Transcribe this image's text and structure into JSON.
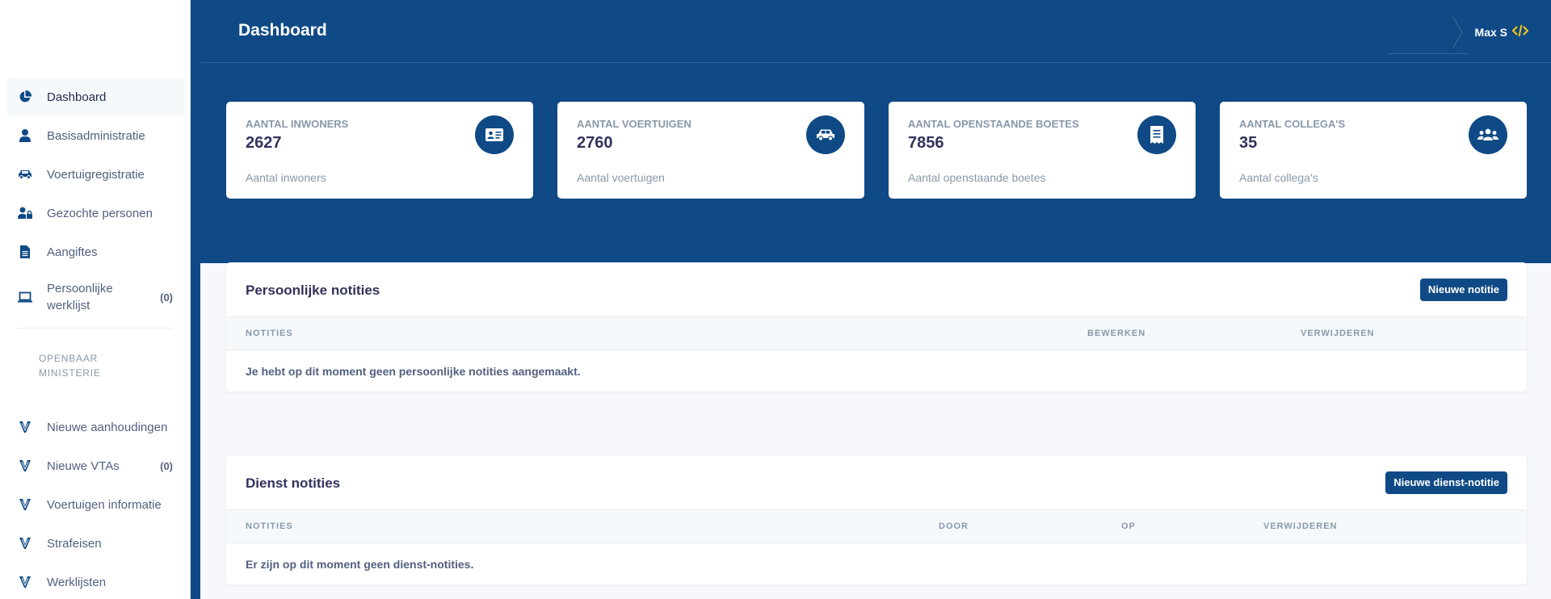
{
  "sidebar": {
    "items": [
      {
        "label": "Dashboard",
        "icon": "chart-pie-icon",
        "active": true
      },
      {
        "label": "Basisadministratie",
        "icon": "user-icon"
      },
      {
        "label": "Voertuigregistratie",
        "icon": "car-icon"
      },
      {
        "label": "Gezochte personen",
        "icon": "user-lock-icon"
      },
      {
        "label": "Aangiftes",
        "icon": "file-icon"
      },
      {
        "label": "Persoonlijke werklijst",
        "icon": "laptop-icon",
        "count": "(0)"
      }
    ],
    "section_heading": "OPENBAAR MINISTERIE",
    "om_items": [
      {
        "label": "Nieuwe aanhoudingen",
        "icon": "scales-icon"
      },
      {
        "label": "Nieuwe VTAs",
        "icon": "scales-icon",
        "count": "(0)"
      },
      {
        "label": "Voertuigen informatie",
        "icon": "scales-icon"
      },
      {
        "label": "Strafeisen",
        "icon": "scales-icon"
      },
      {
        "label": "Werklijsten",
        "icon": "scales-icon"
      }
    ]
  },
  "header": {
    "title": "Dashboard",
    "user_name": "Max S",
    "user_icon": "code-icon"
  },
  "stats": [
    {
      "title": "AANTAL INWONERS",
      "value": "2627",
      "subtitle": "Aantal inwoners",
      "icon": "id-card-icon"
    },
    {
      "title": "AANTAL VOERTUIGEN",
      "value": "2760",
      "subtitle": "Aantal voertuigen",
      "icon": "car-icon"
    },
    {
      "title": "AANTAL OPENSTAANDE BOETES",
      "value": "7856",
      "subtitle": "Aantal openstaande boetes",
      "icon": "receipt-icon"
    },
    {
      "title": "AANTAL COLLEGA'S",
      "value": "35",
      "subtitle": "Aantal collega's",
      "icon": "users-icon"
    }
  ],
  "personal_notes": {
    "title": "Persoonlijke notities",
    "button": "Nieuwe notitie",
    "columns": [
      "NOTITIES",
      "BEWERKEN",
      "VERWIJDEREN"
    ],
    "empty": "Je hebt op dit moment geen persoonlijke notities aangemaakt."
  },
  "service_notes": {
    "title": "Dienst notities",
    "button": "Nieuwe dienst-notitie",
    "columns": [
      "NOTITIES",
      "DOOR",
      "OP",
      "VERWIJDEREN"
    ],
    "empty": "Er zijn op dit moment geen dienst-notities."
  },
  "colors": {
    "brand": "#0f4a86",
    "accent": "#f5c518",
    "muted": "#8898aa"
  }
}
